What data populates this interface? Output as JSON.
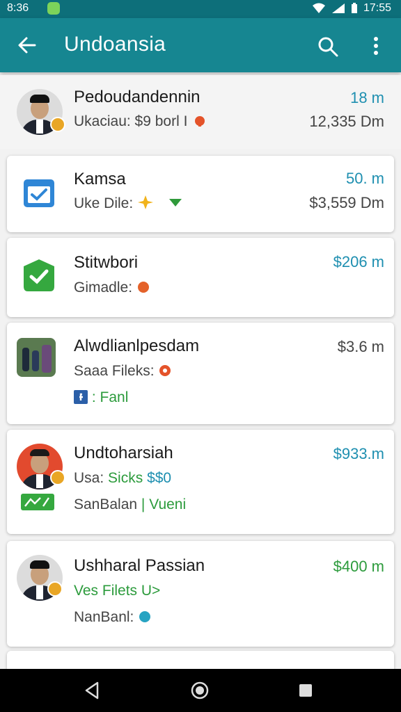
{
  "status": {
    "time": "8:36",
    "clock_right": "17:55"
  },
  "appbar": {
    "title": "Undoansia"
  },
  "rows": [
    {
      "name": "Pedoudandennin",
      "detail": "Ukaciau: $9 borl I",
      "amount": "18 m",
      "amount2": "12,335 Dm"
    },
    {
      "name": "Kamsa",
      "detail": "Uke Dile:",
      "amount": "50. m",
      "amount2": "$3,559 Dm"
    },
    {
      "name": "Stitwbori",
      "detail": "Gimadle:",
      "amount": "$206 m"
    },
    {
      "name": "Alwdlianlpesdam",
      "detail": "Saaa Fileks:",
      "extra": ": Fanl",
      "amount": "$3.6 m"
    },
    {
      "name": "Undtoharsiah",
      "detail_a": "Usa:",
      "detail_b": "Sicks",
      "detail_c": "$$0",
      "extra_a": "SanBalan",
      "extra_b": "| Vueni",
      "amount": "$933.m"
    },
    {
      "name": "Ushharal Passian",
      "detail": "Ves Filets U>",
      "extra": "NanBanl:",
      "amount": "$400 m"
    }
  ],
  "colors": {
    "appbar": "#168691",
    "status": "#0d6f7a",
    "teal_text": "#1e8fb0",
    "green_text": "#2c9b3c"
  }
}
